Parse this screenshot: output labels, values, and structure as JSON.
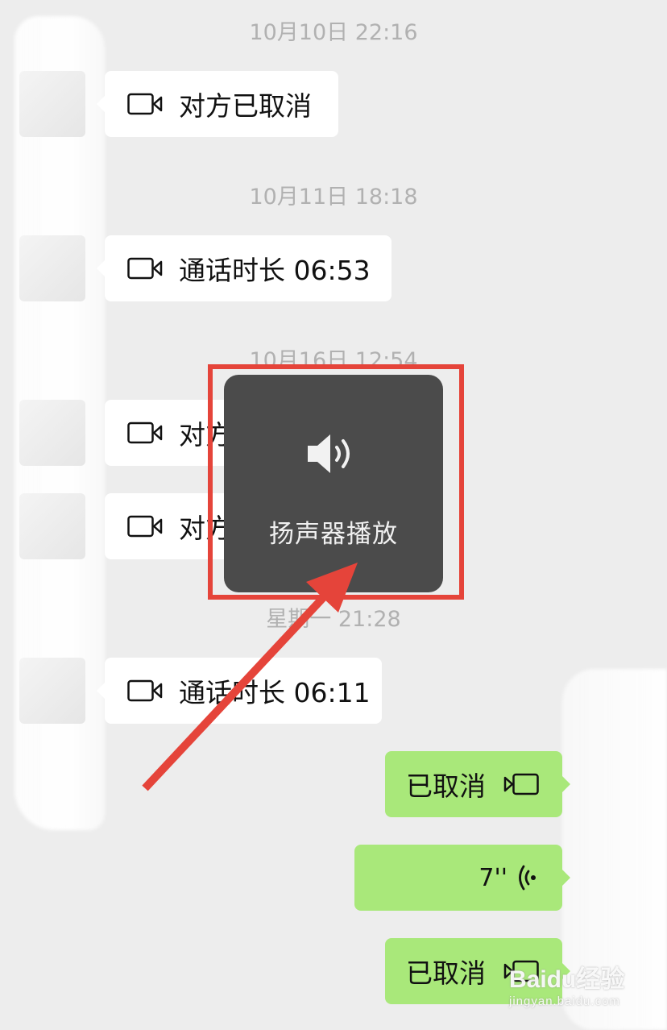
{
  "colors": {
    "background": "#ededed",
    "incoming_bubble": "#ffffff",
    "outgoing_bubble": "#a9e87a",
    "popup_bg": "#4b4b4b",
    "annotation_red": "#e5443a",
    "timestamp_text": "#b1b1b1"
  },
  "chat": {
    "timestamps": [
      "10月10日 22:16",
      "10月11日 18:18",
      "10月16日 12:54",
      "星期一 21:28"
    ],
    "messages": [
      {
        "direction": "in",
        "type": "video-call",
        "text": "对方已取消",
        "icon": "video-camera-icon"
      },
      {
        "direction": "in",
        "type": "video-call",
        "text": "通话时长 06:53",
        "icon": "video-camera-icon"
      },
      {
        "direction": "in",
        "type": "video-call",
        "text": "对方",
        "icon": "video-camera-icon"
      },
      {
        "direction": "in",
        "type": "video-call",
        "text": "对方",
        "icon": "video-camera-icon"
      },
      {
        "direction": "in",
        "type": "video-call",
        "text": "通话时长 06:11",
        "icon": "video-camera-icon"
      },
      {
        "direction": "out",
        "type": "video-call",
        "text": "已取消",
        "icon": "video-camera-icon"
      },
      {
        "direction": "out",
        "type": "voice",
        "text": "7''",
        "icon": "voice-wave-icon"
      },
      {
        "direction": "out",
        "type": "video-call",
        "text": "已取消",
        "icon": "video-camera-icon"
      }
    ]
  },
  "popup": {
    "label": "扬声器播放",
    "icon": "speaker-icon"
  },
  "watermark": {
    "main": "Baidu经验",
    "sub": "jingyan.baidu.com"
  }
}
